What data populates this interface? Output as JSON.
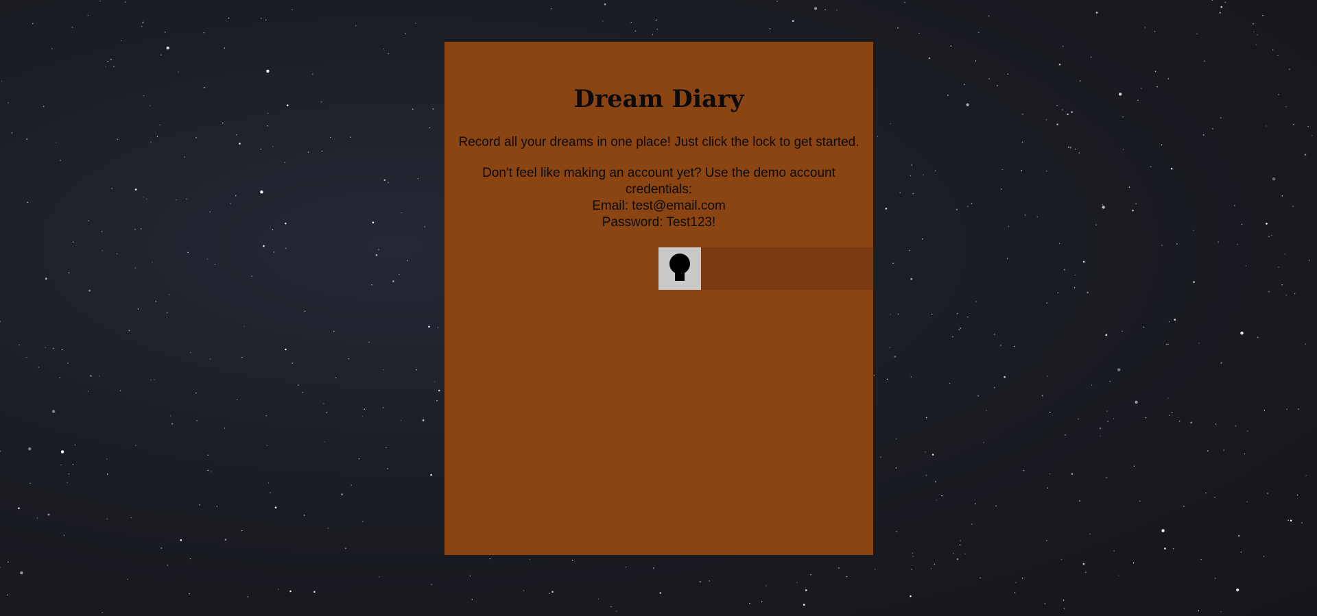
{
  "app": {
    "title": "Dream Diary"
  },
  "intro": {
    "text": "Record all your dreams in one place! Just click the lock to get started."
  },
  "demo": {
    "line1": "Don't feel like making an account yet? Use the demo account credentials:",
    "email": "Email: test@email.com",
    "password": "Password: Test123!"
  },
  "lock": {
    "icon": "keyhole-icon"
  },
  "colors": {
    "diary_cover": "#8b4513",
    "lock_strip": "#7a3b12",
    "lock_button": "#c9c9c9",
    "background": "#1b1d24"
  }
}
